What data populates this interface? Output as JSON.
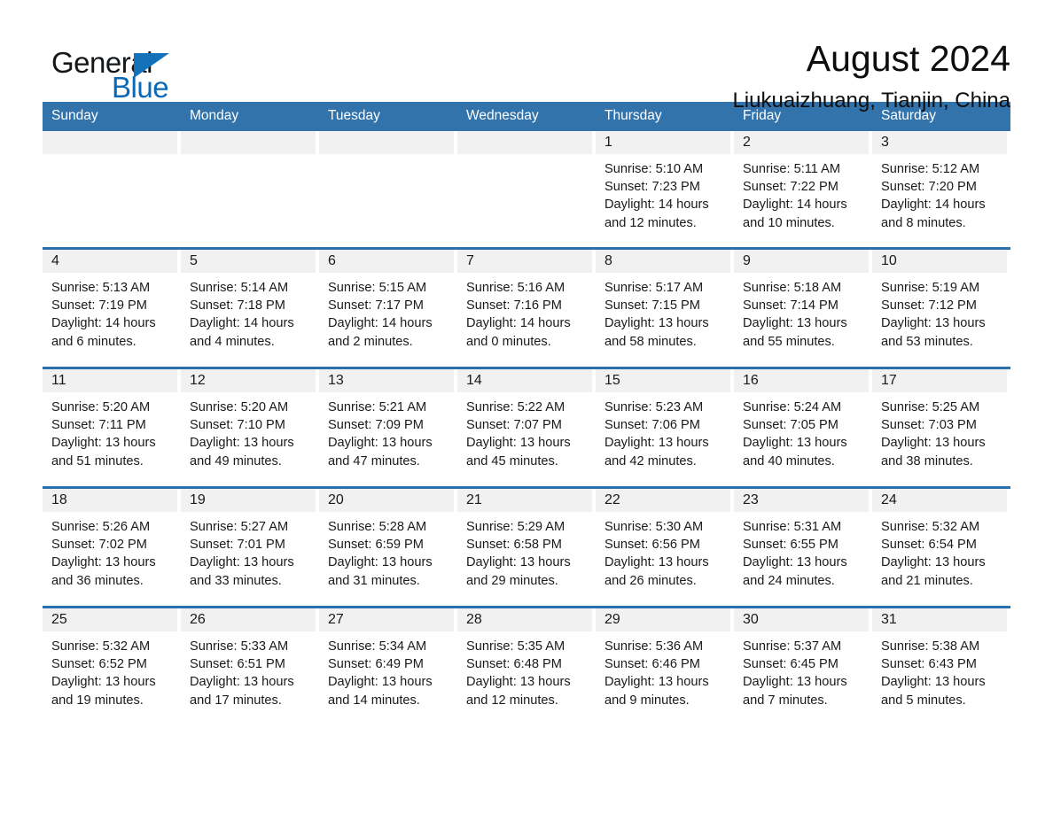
{
  "brand": {
    "word_general": "General",
    "word_blue": "Blue",
    "triangle_color": "#1271b8",
    "blue_text_color": "#0b68b4"
  },
  "header": {
    "month_title": "August 2024",
    "location": "Liukuaizhuang, Tianjin, China"
  },
  "theme": {
    "header_blue": "#3273ac",
    "row_divider_blue": "#2a6fae",
    "daynum_band": "#f1f1f1",
    "page_background": "#ffffff",
    "text": "#1a1a1a"
  },
  "calendar": {
    "weekday_headers": [
      "Sunday",
      "Monday",
      "Tuesday",
      "Wednesday",
      "Thursday",
      "Friday",
      "Saturday"
    ],
    "weeks": [
      [
        {
          "day": "",
          "lines": []
        },
        {
          "day": "",
          "lines": []
        },
        {
          "day": "",
          "lines": []
        },
        {
          "day": "",
          "lines": []
        },
        {
          "day": "1",
          "lines": [
            "Sunrise: 5:10 AM",
            "Sunset: 7:23 PM",
            "Daylight: 14 hours",
            "and 12 minutes."
          ]
        },
        {
          "day": "2",
          "lines": [
            "Sunrise: 5:11 AM",
            "Sunset: 7:22 PM",
            "Daylight: 14 hours",
            "and 10 minutes."
          ]
        },
        {
          "day": "3",
          "lines": [
            "Sunrise: 5:12 AM",
            "Sunset: 7:20 PM",
            "Daylight: 14 hours",
            "and 8 minutes."
          ]
        }
      ],
      [
        {
          "day": "4",
          "lines": [
            "Sunrise: 5:13 AM",
            "Sunset: 7:19 PM",
            "Daylight: 14 hours",
            "and 6 minutes."
          ]
        },
        {
          "day": "5",
          "lines": [
            "Sunrise: 5:14 AM",
            "Sunset: 7:18 PM",
            "Daylight: 14 hours",
            "and 4 minutes."
          ]
        },
        {
          "day": "6",
          "lines": [
            "Sunrise: 5:15 AM",
            "Sunset: 7:17 PM",
            "Daylight: 14 hours",
            "and 2 minutes."
          ]
        },
        {
          "day": "7",
          "lines": [
            "Sunrise: 5:16 AM",
            "Sunset: 7:16 PM",
            "Daylight: 14 hours",
            "and 0 minutes."
          ]
        },
        {
          "day": "8",
          "lines": [
            "Sunrise: 5:17 AM",
            "Sunset: 7:15 PM",
            "Daylight: 13 hours",
            "and 58 minutes."
          ]
        },
        {
          "day": "9",
          "lines": [
            "Sunrise: 5:18 AM",
            "Sunset: 7:14 PM",
            "Daylight: 13 hours",
            "and 55 minutes."
          ]
        },
        {
          "day": "10",
          "lines": [
            "Sunrise: 5:19 AM",
            "Sunset: 7:12 PM",
            "Daylight: 13 hours",
            "and 53 minutes."
          ]
        }
      ],
      [
        {
          "day": "11",
          "lines": [
            "Sunrise: 5:20 AM",
            "Sunset: 7:11 PM",
            "Daylight: 13 hours",
            "and 51 minutes."
          ]
        },
        {
          "day": "12",
          "lines": [
            "Sunrise: 5:20 AM",
            "Sunset: 7:10 PM",
            "Daylight: 13 hours",
            "and 49 minutes."
          ]
        },
        {
          "day": "13",
          "lines": [
            "Sunrise: 5:21 AM",
            "Sunset: 7:09 PM",
            "Daylight: 13 hours",
            "and 47 minutes."
          ]
        },
        {
          "day": "14",
          "lines": [
            "Sunrise: 5:22 AM",
            "Sunset: 7:07 PM",
            "Daylight: 13 hours",
            "and 45 minutes."
          ]
        },
        {
          "day": "15",
          "lines": [
            "Sunrise: 5:23 AM",
            "Sunset: 7:06 PM",
            "Daylight: 13 hours",
            "and 42 minutes."
          ]
        },
        {
          "day": "16",
          "lines": [
            "Sunrise: 5:24 AM",
            "Sunset: 7:05 PM",
            "Daylight: 13 hours",
            "and 40 minutes."
          ]
        },
        {
          "day": "17",
          "lines": [
            "Sunrise: 5:25 AM",
            "Sunset: 7:03 PM",
            "Daylight: 13 hours",
            "and 38 minutes."
          ]
        }
      ],
      [
        {
          "day": "18",
          "lines": [
            "Sunrise: 5:26 AM",
            "Sunset: 7:02 PM",
            "Daylight: 13 hours",
            "and 36 minutes."
          ]
        },
        {
          "day": "19",
          "lines": [
            "Sunrise: 5:27 AM",
            "Sunset: 7:01 PM",
            "Daylight: 13 hours",
            "and 33 minutes."
          ]
        },
        {
          "day": "20",
          "lines": [
            "Sunrise: 5:28 AM",
            "Sunset: 6:59 PM",
            "Daylight: 13 hours",
            "and 31 minutes."
          ]
        },
        {
          "day": "21",
          "lines": [
            "Sunrise: 5:29 AM",
            "Sunset: 6:58 PM",
            "Daylight: 13 hours",
            "and 29 minutes."
          ]
        },
        {
          "day": "22",
          "lines": [
            "Sunrise: 5:30 AM",
            "Sunset: 6:56 PM",
            "Daylight: 13 hours",
            "and 26 minutes."
          ]
        },
        {
          "day": "23",
          "lines": [
            "Sunrise: 5:31 AM",
            "Sunset: 6:55 PM",
            "Daylight: 13 hours",
            "and 24 minutes."
          ]
        },
        {
          "day": "24",
          "lines": [
            "Sunrise: 5:32 AM",
            "Sunset: 6:54 PM",
            "Daylight: 13 hours",
            "and 21 minutes."
          ]
        }
      ],
      [
        {
          "day": "25",
          "lines": [
            "Sunrise: 5:32 AM",
            "Sunset: 6:52 PM",
            "Daylight: 13 hours",
            "and 19 minutes."
          ]
        },
        {
          "day": "26",
          "lines": [
            "Sunrise: 5:33 AM",
            "Sunset: 6:51 PM",
            "Daylight: 13 hours",
            "and 17 minutes."
          ]
        },
        {
          "day": "27",
          "lines": [
            "Sunrise: 5:34 AM",
            "Sunset: 6:49 PM",
            "Daylight: 13 hours",
            "and 14 minutes."
          ]
        },
        {
          "day": "28",
          "lines": [
            "Sunrise: 5:35 AM",
            "Sunset: 6:48 PM",
            "Daylight: 13 hours",
            "and 12 minutes."
          ]
        },
        {
          "day": "29",
          "lines": [
            "Sunrise: 5:36 AM",
            "Sunset: 6:46 PM",
            "Daylight: 13 hours",
            "and 9 minutes."
          ]
        },
        {
          "day": "30",
          "lines": [
            "Sunrise: 5:37 AM",
            "Sunset: 6:45 PM",
            "Daylight: 13 hours",
            "and 7 minutes."
          ]
        },
        {
          "day": "31",
          "lines": [
            "Sunrise: 5:38 AM",
            "Sunset: 6:43 PM",
            "Daylight: 13 hours",
            "and 5 minutes."
          ]
        }
      ]
    ]
  }
}
